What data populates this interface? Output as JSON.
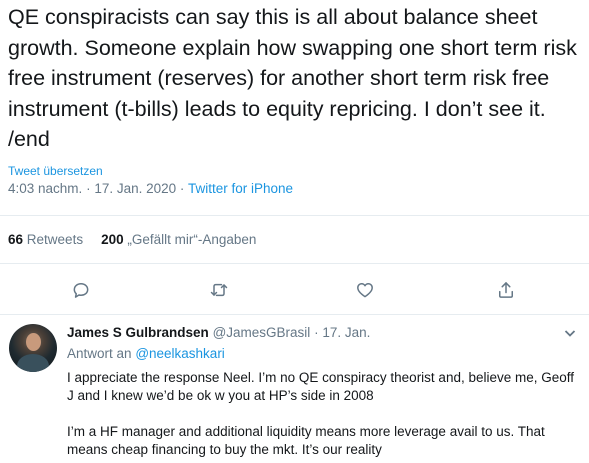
{
  "tweet": {
    "text": "QE conspiracists can say this is all about balance sheet growth. Someone explain how swapping one short term risk free instrument (reserves) for another short term risk free instrument (t-bills) leads to equity repricing. I don’t see it. /end",
    "translate_label": "Tweet übersetzen",
    "time": "4:03 nachm.",
    "separator": "·",
    "date": "17. Jan. 2020",
    "source": "Twitter for iPhone",
    "retweets_count": "66",
    "retweets_label": "Retweets",
    "likes_count": "200",
    "likes_label": "„Gefällt mir“-Angaben"
  },
  "actions": [
    {
      "name": "reply",
      "icon": "reply-icon"
    },
    {
      "name": "retweet",
      "icon": "retweet-icon"
    },
    {
      "name": "like",
      "icon": "heart-icon"
    },
    {
      "name": "share",
      "icon": "share-icon"
    }
  ],
  "reply": {
    "name": "James S Gulbrandsen",
    "handle": "@JamesGBrasil",
    "separator": "·",
    "date": "17. Jan.",
    "reply_to_label": "Antwort an",
    "reply_to_user": "@neelkashkari",
    "paragraph_1": "I appreciate the response Neel. I’m no QE conspiracy theorist and, believe me, Geoff J and I knew we’d be ok w you at HP’s side in 2008",
    "paragraph_2": "I’m a HF manager and additional liquidity means more leverage avail to us. That means cheap financing to buy the mkt. It’s our reality"
  },
  "colors": {
    "text": "#14171a",
    "secondary": "#657786",
    "link": "#1b95e0",
    "divider": "#e6ecf0"
  }
}
